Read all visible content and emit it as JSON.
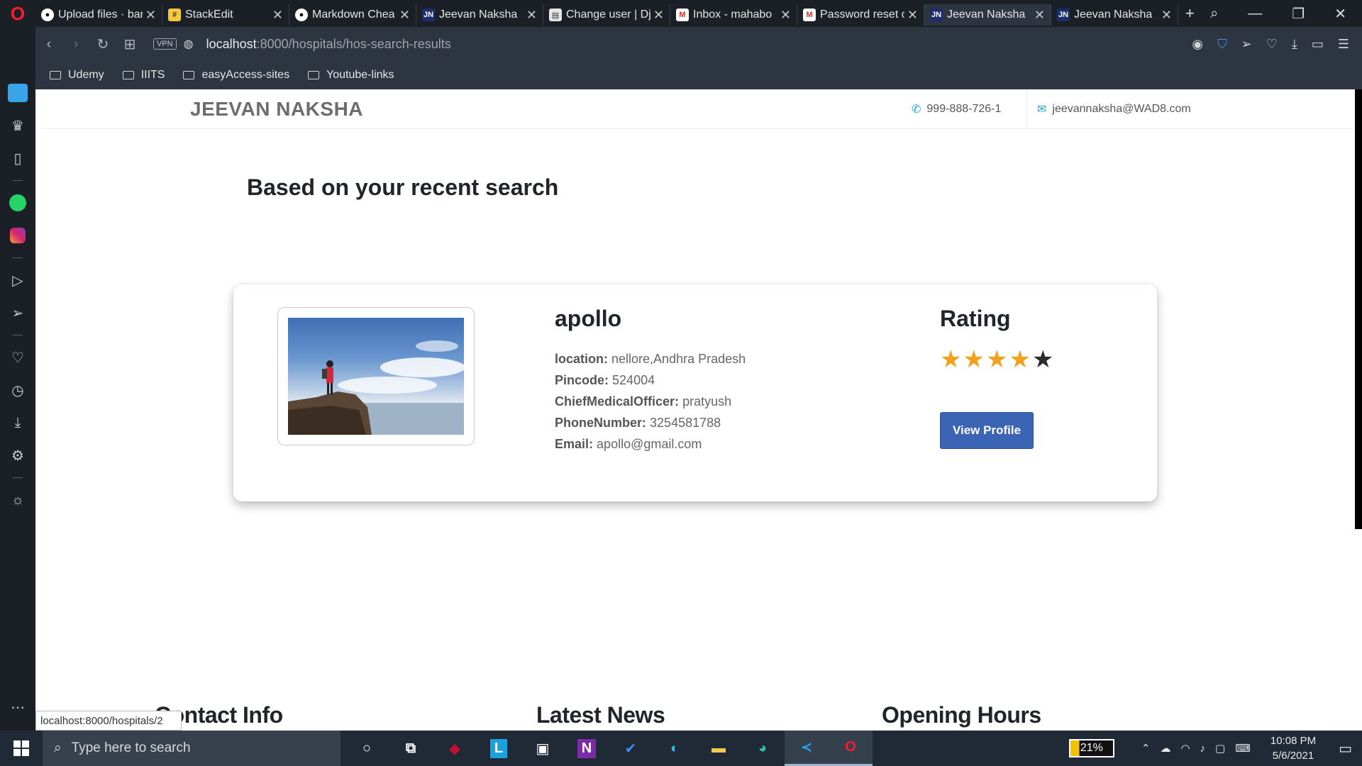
{
  "browser": {
    "tabs": [
      {
        "title": "Upload files · bar",
        "favicon": "github-icon",
        "active": false
      },
      {
        "title": "StackEdit",
        "favicon": "stackedit-icon",
        "active": false
      },
      {
        "title": "Markdown Chea",
        "favicon": "github-icon",
        "active": false
      },
      {
        "title": "Jeevan Naksha",
        "favicon": "jn-icon",
        "active": false
      },
      {
        "title": "Change user | Dj",
        "favicon": "document-icon",
        "active": false
      },
      {
        "title": "Inbox - mahabo",
        "favicon": "gmail-icon",
        "active": false
      },
      {
        "title": "Password reset o",
        "favicon": "gmail-icon",
        "active": false
      },
      {
        "title": "Jeevan Naksha",
        "favicon": "jn-icon",
        "active": true
      },
      {
        "title": "Jeevan Naksha",
        "favicon": "jn-icon",
        "active": false
      }
    ],
    "url_host": "localhost",
    "url_path": ":8000/hospitals/hos-search-results",
    "vpn_label": "VPN",
    "bookmarks": [
      "Udemy",
      "IIITS",
      "easyAccess-sites",
      "Youtube-links"
    ],
    "status_url": "localhost:8000/hospitals/2"
  },
  "site": {
    "brand": "JEEVAN NAKSHA",
    "phone": "999-888-726-1",
    "email": "jeevannaksha@WAD8.com"
  },
  "main": {
    "heading": "Based on your recent search"
  },
  "hospital": {
    "name": "apollo",
    "location_label": "location:",
    "location": "nellore,Andhra Pradesh",
    "pincode_label": "Pincode:",
    "pincode": "524004",
    "cmo_label": "ChiefMedicalOfficer:",
    "cmo": "pratyush",
    "phone_label": "PhoneNumber:",
    "phone": "3254581788",
    "email_label": "Email:",
    "email": "apollo@gmail.com",
    "rating_title": "Rating",
    "rating": 4,
    "rating_max": 5,
    "view_button": "View Profile"
  },
  "footer": {
    "contact": "Contact Info",
    "news": "Latest News",
    "hours": "Opening Hours"
  },
  "taskbar": {
    "search_placeholder": "Type here to search",
    "battery": "21%",
    "time": "10:08 PM",
    "date": "5/6/2021"
  },
  "colors": {
    "accent": "#3b64b5",
    "star": "#f2a11c",
    "brand_text": "#6d6d6d"
  }
}
